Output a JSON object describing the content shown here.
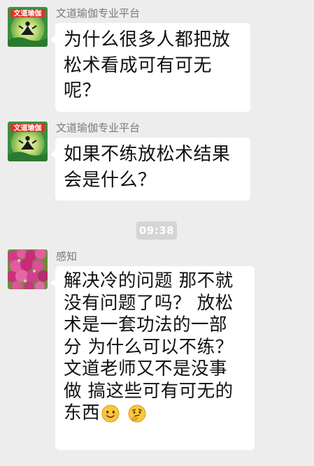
{
  "messages": [
    {
      "sender": "文道瑜伽专业平台",
      "avatar_text": "文道瑜伽",
      "lines": [
        "为什么很多人都把放",
        "松术看成可有可无",
        "呢？"
      ]
    },
    {
      "sender": "文道瑜伽专业平台",
      "avatar_text": "文道瑜伽",
      "lines": [
        "如果不练放松术结果",
        "会是什么？"
      ]
    },
    {
      "sender": "感知",
      "lines": [
        "解决冷的问题 那不就",
        "没有问题了吗？ 放松",
        "术是一套功法的一部",
        "分 为什么可以不练？",
        "文道老师又不是没事",
        "做 搞这些可有可无的",
        "东西"
      ]
    }
  ],
  "timestamp": "09:38",
  "emojis": [
    "smiling-face",
    "thinking-face"
  ]
}
